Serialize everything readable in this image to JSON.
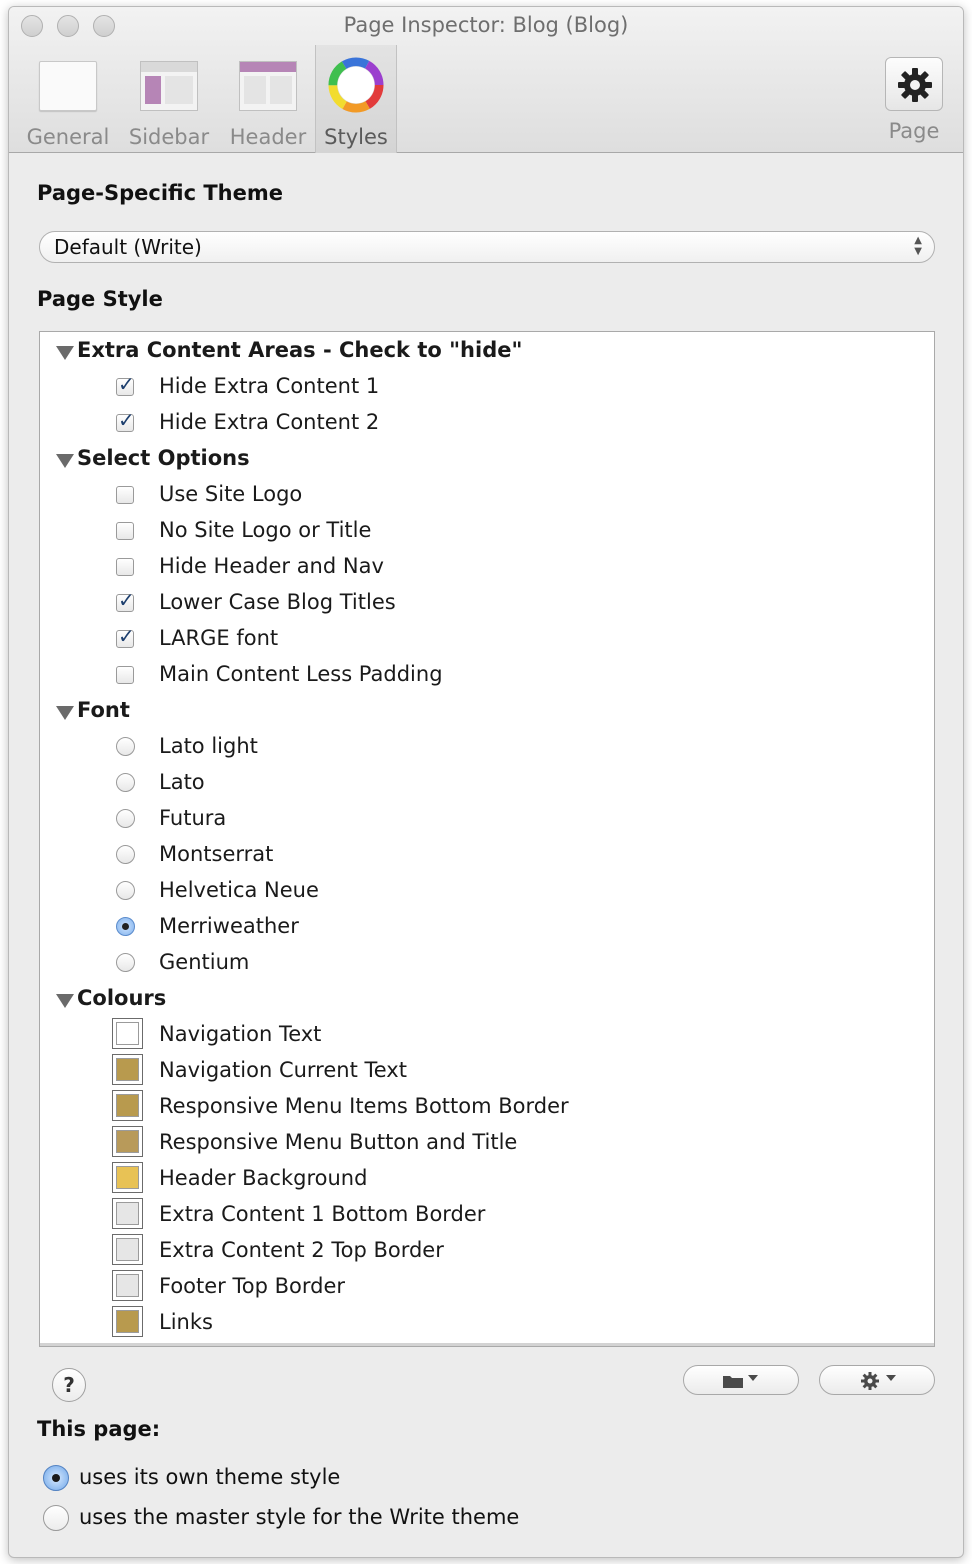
{
  "window": {
    "title": "Page Inspector: Blog (Blog)"
  },
  "toolbar": {
    "tabs": [
      {
        "label": "General",
        "icon": "page-icon"
      },
      {
        "label": "Sidebar",
        "icon": "sidebar-layout-icon"
      },
      {
        "label": "Header",
        "icon": "header-layout-icon"
      },
      {
        "label": "Styles",
        "icon": "color-wheel-icon",
        "active": true
      }
    ],
    "page_label": "Page"
  },
  "theme": {
    "heading": "Page-Specific Theme",
    "selected": "Default (Write)"
  },
  "style": {
    "heading": "Page Style",
    "groups": [
      {
        "title": "Extra Content Areas - Check to \"hide\"",
        "items": [
          {
            "label": "Hide Extra Content 1",
            "type": "checkbox",
            "checked": true
          },
          {
            "label": "Hide Extra Content 2",
            "type": "checkbox",
            "checked": true
          }
        ]
      },
      {
        "title": "Select Options",
        "items": [
          {
            "label": "Use Site Logo",
            "type": "checkbox",
            "checked": false
          },
          {
            "label": "No Site Logo or Title",
            "type": "checkbox",
            "checked": false
          },
          {
            "label": "Hide Header and Nav",
            "type": "checkbox",
            "checked": false
          },
          {
            "label": "Lower Case Blog Titles",
            "type": "checkbox",
            "checked": true
          },
          {
            "label": "LARGE font",
            "type": "checkbox",
            "checked": true
          },
          {
            "label": "Main Content Less Padding",
            "type": "checkbox",
            "checked": false
          }
        ]
      },
      {
        "title": "Font",
        "items": [
          {
            "label": "Lato light",
            "type": "radio",
            "checked": false
          },
          {
            "label": "Lato",
            "type": "radio",
            "checked": false
          },
          {
            "label": "Futura",
            "type": "radio",
            "checked": false
          },
          {
            "label": "Montserrat",
            "type": "radio",
            "checked": false
          },
          {
            "label": "Helvetica Neue",
            "type": "radio",
            "checked": false
          },
          {
            "label": "Merriweather",
            "type": "radio",
            "checked": true
          },
          {
            "label": "Gentium",
            "type": "radio",
            "checked": false
          }
        ]
      },
      {
        "title": "Colours",
        "items": [
          {
            "label": "Navigation Text",
            "type": "color",
            "color": "#ffffff"
          },
          {
            "label": "Navigation Current Text",
            "type": "color",
            "color": "#b89a4e"
          },
          {
            "label": "Responsive Menu Items Bottom Border",
            "type": "color",
            "color": "#b89a4e"
          },
          {
            "label": "Responsive Menu Button and Title",
            "type": "color",
            "color": "#b89a5a"
          },
          {
            "label": "Header Background",
            "type": "color",
            "color": "#e8c255"
          },
          {
            "label": "Extra Content 1 Bottom Border",
            "type": "color",
            "color": "#e6e6e6"
          },
          {
            "label": "Extra Content 2 Top Border",
            "type": "color",
            "color": "#e6e6e6"
          },
          {
            "label": "Footer Top Border",
            "type": "color",
            "color": "#e6e6e6"
          },
          {
            "label": "Links",
            "type": "color",
            "color": "#b89a4e"
          }
        ]
      }
    ]
  },
  "footer": {
    "help_label": "?",
    "this_page_heading": "This page:",
    "options": [
      {
        "label": "uses its own theme style",
        "selected": true
      },
      {
        "label": "uses the master style for the Write theme",
        "selected": false
      }
    ]
  }
}
